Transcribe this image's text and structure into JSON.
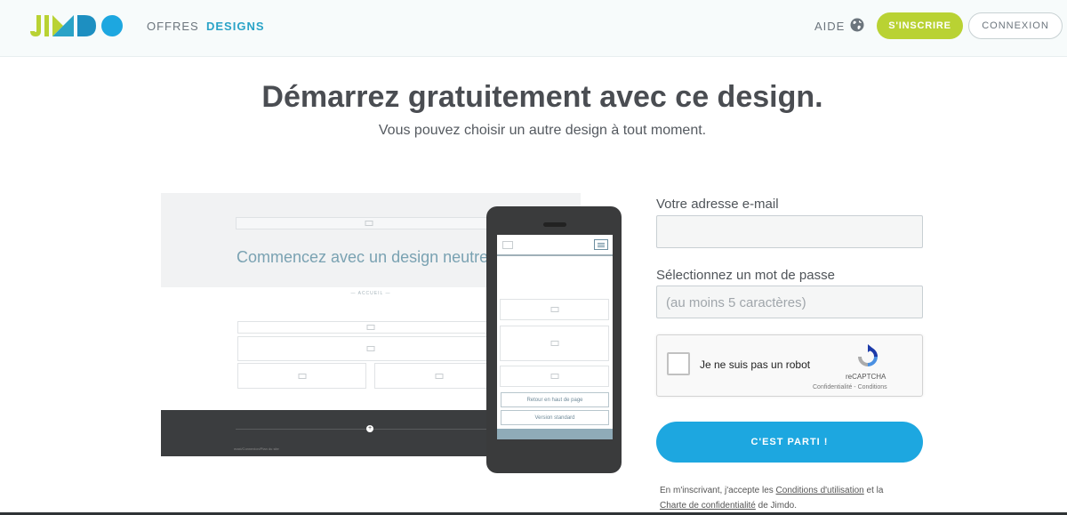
{
  "header": {
    "logo_text": "JIMDO",
    "nav": {
      "offres": "OFFRES",
      "designs": "DESIGNS"
    },
    "aide": "AIDE",
    "signup": "S'INSCRIRE",
    "login": "CONNEXION"
  },
  "hero": {
    "title": "Démarrez gratuitement avec ce design.",
    "subtitle": "Vous pouvez choisir un autre design à tout moment."
  },
  "preview": {
    "headline": "Commencez avec un design neutre",
    "nav_label": "— ACCUEIL —",
    "footer_text": "maxi/Connexion/Plan du site",
    "phone_back_to_top": "Retour en haut de page",
    "phone_standard": "Version standard"
  },
  "form": {
    "email_label": "Votre adresse e-mail",
    "email_value": "",
    "password_label": "Sélectionnez un mot de passe",
    "password_placeholder": "(au moins 5 caractères)",
    "recaptcha_text": "Je ne suis pas un robot",
    "recaptcha_brand": "reCAPTCHA",
    "recaptcha_links": "Confidentialité - Conditions",
    "submit": "C'EST PARTI !",
    "terms_prefix": "En m'inscrivant, j'accepte les ",
    "terms_link1": "Conditions d'utilisation",
    "terms_mid": " et la ",
    "terms_link2": "Charte de confidentialité",
    "terms_suffix": " de Jimdo."
  },
  "colors": {
    "accent_green": "#b9d233",
    "accent_blue": "#1da7e0",
    "designs_link": "#2aa3c7"
  }
}
